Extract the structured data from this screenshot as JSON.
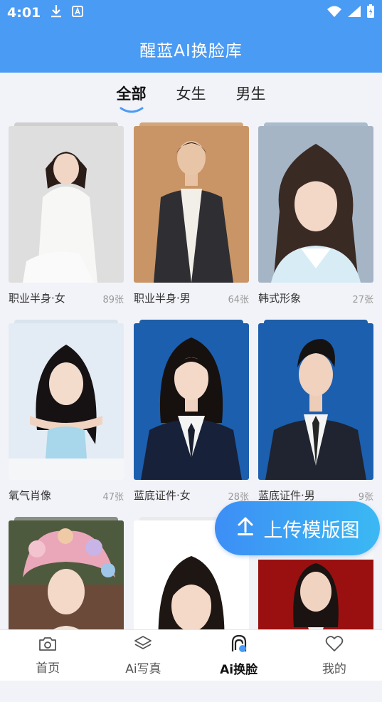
{
  "status_bar": {
    "time": "4:01"
  },
  "app_bar": {
    "title": "醒蓝AI换脸库"
  },
  "tabs": [
    {
      "label": "全部",
      "active": true
    },
    {
      "label": "女生",
      "active": false
    },
    {
      "label": "男生",
      "active": false
    }
  ],
  "cards": [
    {
      "name": "职业半身·女",
      "count": "89张"
    },
    {
      "name": "职业半身·男",
      "count": "64张"
    },
    {
      "name": "韩式形象",
      "count": "27张"
    },
    {
      "name": "氧气肖像",
      "count": "47张"
    },
    {
      "name": "蓝底证件·女",
      "count": "28张"
    },
    {
      "name": "蓝底证件·男",
      "count": "9张"
    },
    {
      "name": "",
      "count": ""
    },
    {
      "name": "",
      "count": ""
    },
    {
      "name": "",
      "count": ""
    }
  ],
  "upload_button": {
    "label": "上传模版图"
  },
  "bottom_nav": [
    {
      "label": "首页",
      "icon": "camera-icon",
      "active": false
    },
    {
      "label": "Ai写真",
      "icon": "layers-icon",
      "active": false
    },
    {
      "label": "Ai换脸",
      "icon": "face-swap-icon",
      "active": true
    },
    {
      "label": "我的",
      "icon": "heart-icon",
      "active": false
    }
  ],
  "colors": {
    "primary": "#4a9bf3",
    "background": "#f2f3f8",
    "accent_gradient_end": "#3bb9f3"
  }
}
